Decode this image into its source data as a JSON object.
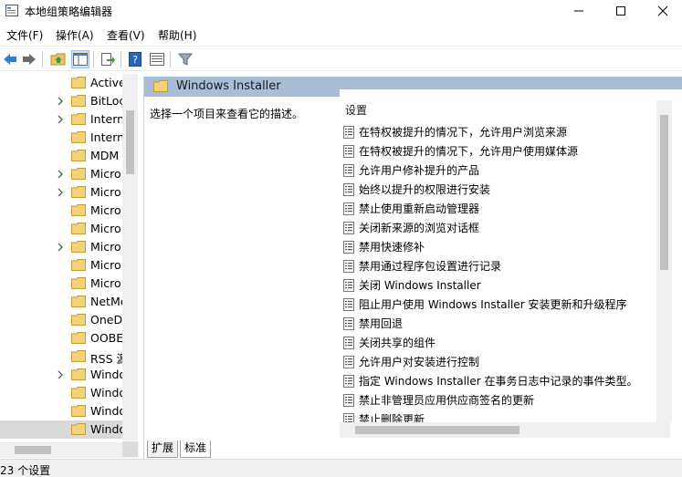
{
  "window": {
    "title": "本地组策略编辑器",
    "minimize_icon": "minimize-icon",
    "maximize_icon": "maximize-icon",
    "close_icon": "close-icon"
  },
  "menu": [
    {
      "label": "文件(F)"
    },
    {
      "label": "操作(A)"
    },
    {
      "label": "查看(V)"
    },
    {
      "label": "帮助(H)"
    }
  ],
  "toolbar": {
    "icons": [
      "back-arrow-icon",
      "forward-arrow-icon",
      "up-folder-icon",
      "show-hide-tree-icon",
      "export-list-icon",
      "help-icon",
      "properties-view-icon",
      "filter-icon"
    ]
  },
  "tree": {
    "items": [
      {
        "label": "Active",
        "expandable": false
      },
      {
        "label": "BitLoc",
        "expandable": true
      },
      {
        "label": "Intern",
        "expandable": true
      },
      {
        "label": "Intern",
        "expandable": false
      },
      {
        "label": "MDM",
        "expandable": false
      },
      {
        "label": "Micro",
        "expandable": true
      },
      {
        "label": "Micro",
        "expandable": true
      },
      {
        "label": "Micro",
        "expandable": false
      },
      {
        "label": "Micro",
        "expandable": false
      },
      {
        "label": "Micro",
        "expandable": true
      },
      {
        "label": "Micro",
        "expandable": false
      },
      {
        "label": "Micro",
        "expandable": false
      },
      {
        "label": "NetMe",
        "expandable": false
      },
      {
        "label": "OneDr",
        "expandable": false
      },
      {
        "label": "OOBE",
        "expandable": false
      },
      {
        "label": "RSS 源",
        "expandable": false
      },
      {
        "label": "Windo",
        "expandable": true
      },
      {
        "label": "Windo",
        "expandable": false
      },
      {
        "label": "Windo",
        "expandable": false
      },
      {
        "label": "Windo",
        "expandable": false,
        "selected": true
      }
    ]
  },
  "right_pane": {
    "header_title": "Windows Installer",
    "description": "选择一个项目来查看它的描述。",
    "column_header": "设置",
    "settings": [
      "在特权被提升的情况下，允许用户浏览来源",
      "在特权被提升的情况下，允许用户使用媒体源",
      "允许用户修补提升的产品",
      "始终以提升的权限进行安装",
      "禁止使用重新启动管理器",
      "关闭新来源的浏览对话框",
      "禁用快速修补",
      "禁用通过程序包设置进行记录",
      "关闭 Windows Installer",
      "阻止用户使用 Windows Installer 安装更新和升级程序",
      "禁用回退",
      "关闭共享的组件",
      "允许用户对安装进行控制",
      "指定 Windows Installer 在事务日志中记录的事件类型。",
      "禁止非管理员应用供应商签名的更新",
      "禁止删除更新"
    ]
  },
  "tabs": [
    {
      "label": "扩展",
      "active": false
    },
    {
      "label": "标准",
      "active": true
    }
  ],
  "status": {
    "text": "23 个设置"
  },
  "colors": {
    "header_band": "#a9bdd6",
    "selection": "#d9d9d9",
    "folder": "#e8c46b"
  }
}
